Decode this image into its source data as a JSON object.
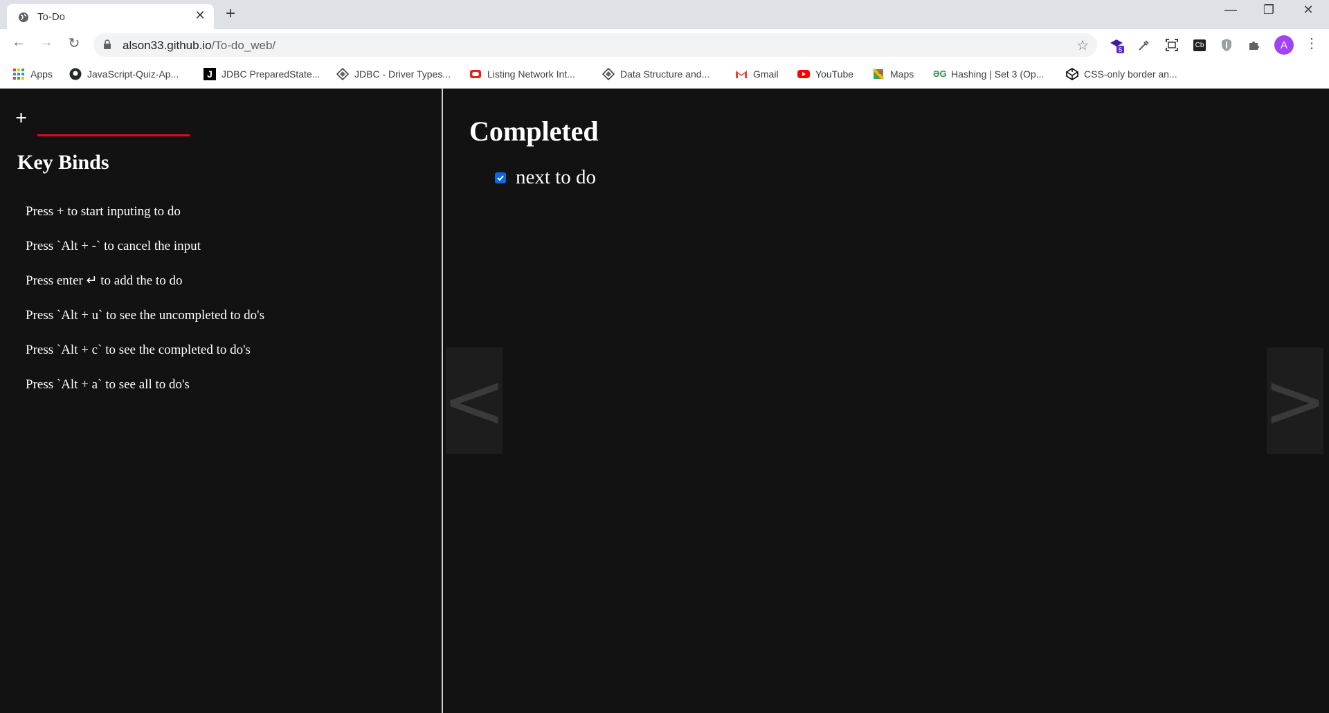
{
  "browser": {
    "tab_title": "To-Do",
    "tab_close": "✕",
    "new_tab": "+",
    "window_controls": {
      "minimize": "—",
      "restore": "❐",
      "close": "✕"
    },
    "nav": {
      "back": "←",
      "forward": "→",
      "reload": "↻"
    },
    "address": {
      "host": "alson33.github.io",
      "path": "/To-do_web/"
    },
    "star": "☆",
    "extensions": [
      {
        "name": "extension-badge-icon",
        "badge": "5"
      },
      {
        "name": "eyedropper-icon"
      },
      {
        "name": "screenshot-icon"
      },
      {
        "name": "cb-extension-icon",
        "label": "Cb"
      },
      {
        "name": "shield-icon"
      },
      {
        "name": "puzzle-icon"
      }
    ],
    "avatar_letter": "A",
    "menu": "⋮",
    "bookmarks": [
      {
        "label": "Apps",
        "icon": "apps-grid-icon"
      },
      {
        "label": "JavaScript-Quiz-Ap...",
        "icon": "github-icon"
      },
      {
        "label": "JDBC PreparedState...",
        "icon": "j-logo-icon"
      },
      {
        "label": "JDBC - Driver Types...",
        "icon": "diamond-logo-icon"
      },
      {
        "label": "Listing Network Int...",
        "icon": "oracle-icon"
      },
      {
        "label": "Data Structure and...",
        "icon": "diamond-logo-icon"
      },
      {
        "label": "Gmail",
        "icon": "gmail-icon"
      },
      {
        "label": "YouTube",
        "icon": "youtube-icon"
      },
      {
        "label": "Maps",
        "icon": "maps-icon"
      },
      {
        "label": "Hashing | Set 3 (Op...",
        "icon": "gfg-icon"
      },
      {
        "label": "CSS-only border an...",
        "icon": "codepen-icon"
      }
    ]
  },
  "sidebar": {
    "add_symbol": "+",
    "input_value": "",
    "keybinds_title": "Key Binds",
    "keybinds": [
      "Press + to start inputing to do",
      "Press `Alt + -` to cancel the input",
      "Press enter ↵ to add the to do",
      "Press `Alt + u` to see the uncompleted to do's",
      "Press `Alt + c` to see the completed to do's",
      "Press `Alt + a` to see all to do's"
    ]
  },
  "main": {
    "section_title": "Completed",
    "todos": [
      {
        "text": "next to do",
        "checked": true
      }
    ],
    "prev_arrow": "<",
    "next_arrow": ">"
  },
  "colors": {
    "page_bg": "#121212",
    "accent_underline": "#e50914",
    "checkbox": "#0b68e0"
  }
}
